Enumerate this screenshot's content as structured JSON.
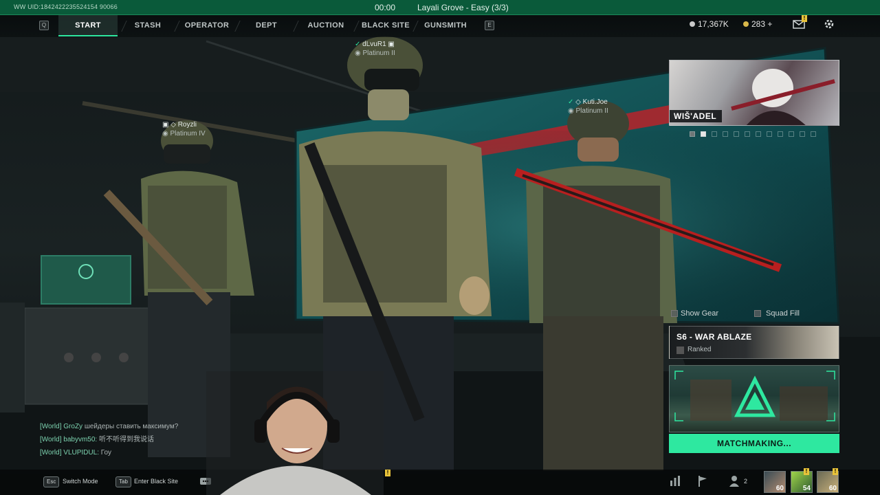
{
  "top_bar": {
    "uid": "WW UID:1842422235524154 90066",
    "timer": "00:00",
    "match_info": "Layali Grove - Easy (3/3)"
  },
  "nav": {
    "left_key": "Q",
    "right_key": "E",
    "tabs": [
      {
        "label": "START",
        "active": true
      },
      {
        "label": "STASH",
        "active": false
      },
      {
        "label": "OPERATOR",
        "active": false
      },
      {
        "label": "DEPT",
        "active": false
      },
      {
        "label": "AUCTION",
        "active": false
      },
      {
        "label": "BLACK SITE",
        "active": false
      },
      {
        "label": "GUNSMITH",
        "active": false
      }
    ]
  },
  "currency": {
    "silver": "17,367K",
    "gold": "283",
    "gold_add": "+"
  },
  "players": [
    {
      "name": "Royzli",
      "rank": "Platinum IV"
    },
    {
      "name": "dLvuR1",
      "rank": "Platinum II"
    },
    {
      "name": "Kuti.Joe",
      "rank": "Platinum II"
    }
  ],
  "event": {
    "label": "WIŠ'ADEL"
  },
  "toggles": {
    "show_gear": "Show Gear",
    "squad_fill": "Squad Fill"
  },
  "season": {
    "title": "S6 - WAR ABLAZE",
    "mode": "Ranked"
  },
  "matchmaking": {
    "label": "MATCHMAKING..."
  },
  "chat": [
    {
      "channel": "[World]",
      "user": "GroZy",
      "message": "шейдеры ставить максимум?"
    },
    {
      "channel": "[World]",
      "user": "babyvm50:",
      "message": "听不听得到我说话"
    },
    {
      "channel": "[World]",
      "user": "VLUPIDUL:",
      "message": "Гоу"
    }
  ],
  "bottom": {
    "switch_key": "Esc",
    "switch_label": "Switch Mode",
    "black_site_key": "Tab",
    "black_site_label": "Enter Black Site",
    "squad_count": "2",
    "slots": [
      "60",
      "54",
      "60"
    ]
  },
  "colors": {
    "accent": "#2ee8a0",
    "top_bar": "#0a5a3a",
    "notification": "#e8c33a"
  },
  "icons": [
    "silver-coin-icon",
    "gold-coin-icon",
    "mail-icon",
    "settings-gear-icon",
    "chat-icon",
    "stats-icon",
    "flag-icon",
    "squad-icon"
  ]
}
